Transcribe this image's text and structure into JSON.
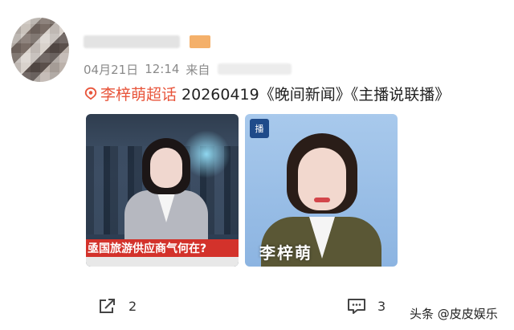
{
  "post": {
    "date": "04月21日",
    "time": "12:14",
    "source_prefix": "来自",
    "topic": "李梓萌超话",
    "text": "20260419《晚间新闻》《主播说联播》"
  },
  "images": [
    {
      "ticker": "亟国旅游供应商气何在?"
    },
    {
      "nameplate": "李梓萌",
      "logo": "播"
    }
  ],
  "actions": {
    "share_count": "2",
    "comment_count": "3"
  },
  "watermark": "头条 @皮皮娱乐",
  "colors": {
    "topic": "#e8553b",
    "meta": "#8a8a8a",
    "ticker_bg": "#d3322b"
  }
}
